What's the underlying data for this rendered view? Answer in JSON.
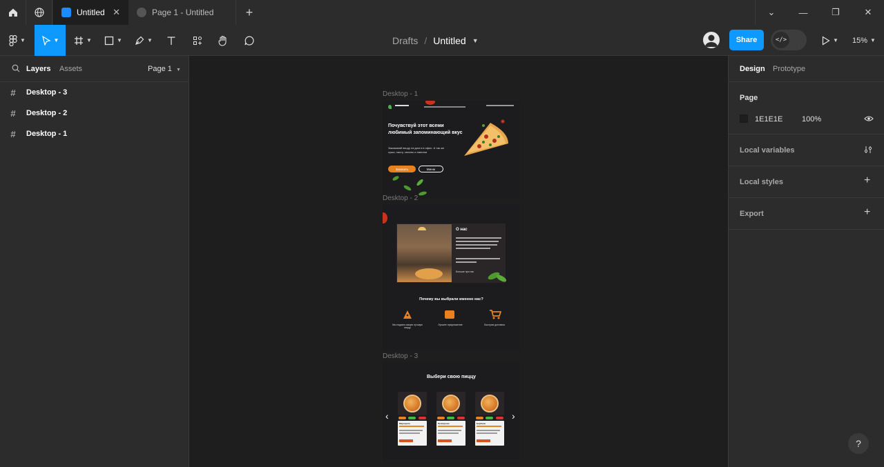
{
  "tabs": [
    {
      "label": "Untitled",
      "active": true
    },
    {
      "label": "Page 1 - Untitled",
      "active": false
    }
  ],
  "toolbar": {
    "breadcrumb_parent": "Drafts",
    "breadcrumb_sep": "/",
    "file_name": "Untitled",
    "share_label": "Share",
    "zoom": "15%"
  },
  "left_panel": {
    "tab_layers": "Layers",
    "tab_assets": "Assets",
    "page_selector": "Page 1",
    "layers": [
      "Desktop - 3",
      "Desktop - 2",
      "Desktop - 1"
    ]
  },
  "right_panel": {
    "tab_design": "Design",
    "tab_prototype": "Prototype",
    "page_section": "Page",
    "page_color": "1E1E1E",
    "page_opacity": "100%",
    "local_variables": "Local variables",
    "local_styles": "Local styles",
    "export": "Export"
  },
  "canvas": {
    "frames": {
      "d1": {
        "label": "Desktop - 1",
        "hero_title": "Почувствуй этот всеми любимый запоминающий вкус",
        "hero_sub": "Заказывай пиццу на дом и в офис. А так же суши, пасту, салаты и напитки",
        "btn_order": "Заказать",
        "btn_menu": "Меню"
      },
      "d2": {
        "label": "Desktop - 2",
        "about_title": "О нас",
        "more_link": "Больше про нас",
        "why_title": "Почему вы выбрали именно нас?",
        "features": [
          {
            "title": "Мы подаем самую лучшую пиццу",
            "icon": "pizza-slice-icon"
          },
          {
            "title": "Лучшее предложение",
            "icon": "wallet-icon"
          },
          {
            "title": "Быстрая доставка",
            "icon": "cart-icon"
          }
        ]
      },
      "d3": {
        "label": "Desktop - 3",
        "title": "Выбери свою пиццу",
        "pizzas": [
          "Маргарита",
          "Пепперони",
          "Барбекю"
        ]
      }
    }
  },
  "colors": {
    "accent": "#0d99ff",
    "orange": "#e8821f",
    "panel": "#2c2c2c",
    "canvas": "#1e1e1e"
  },
  "help_label": "?"
}
